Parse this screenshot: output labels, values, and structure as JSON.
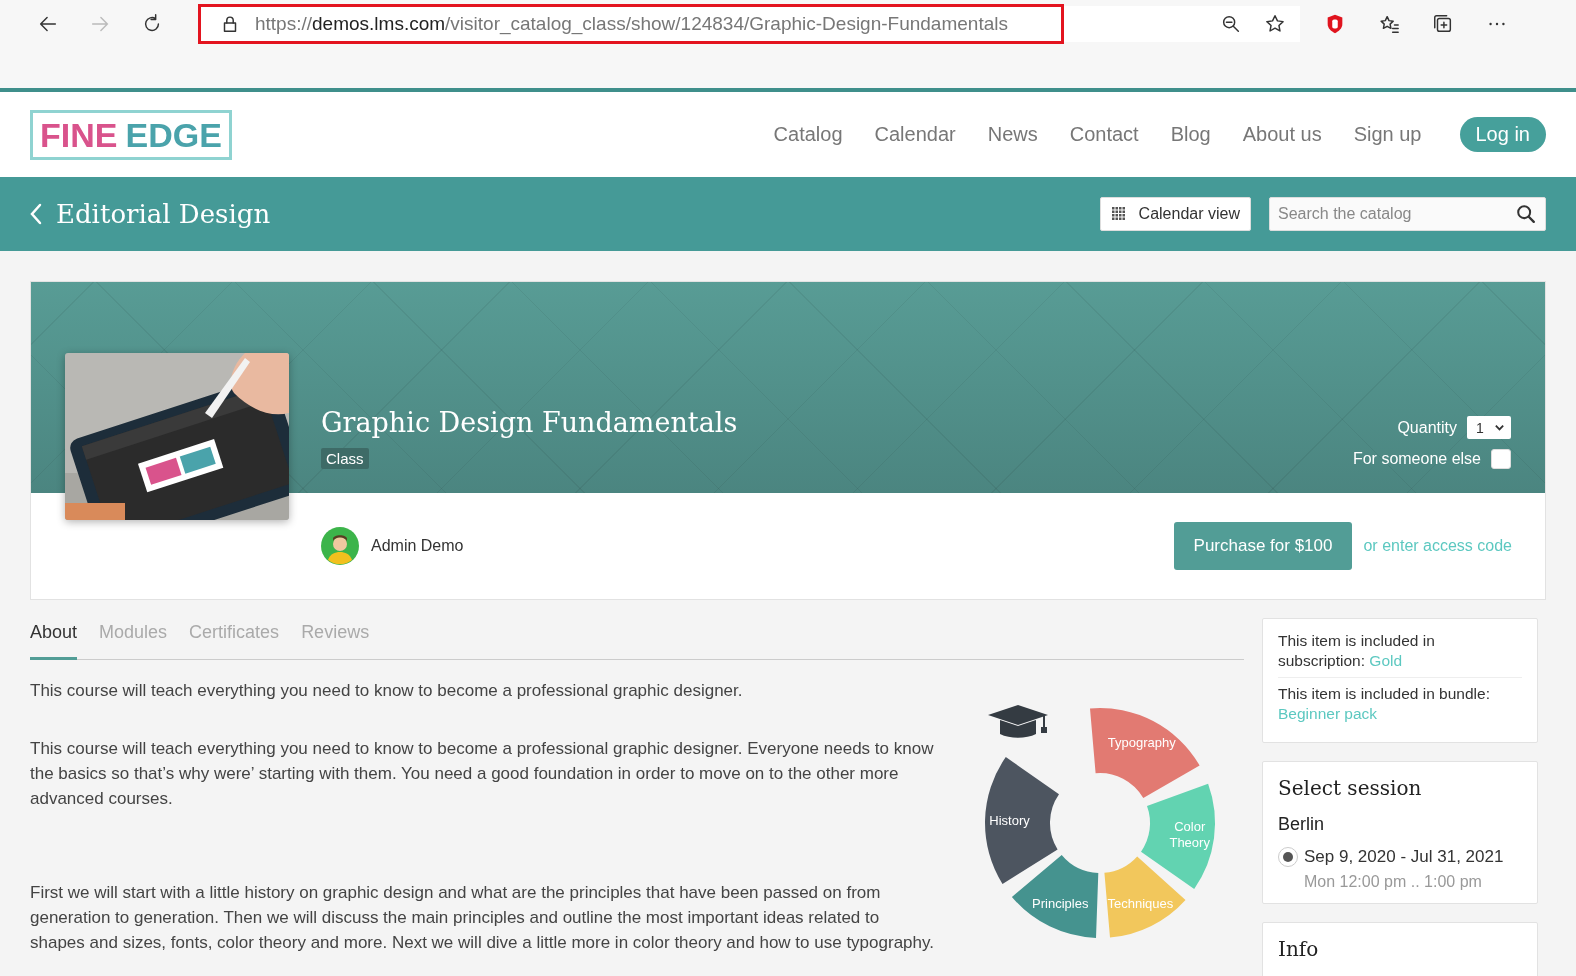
{
  "browser": {
    "url": {
      "scheme": "https://",
      "host": "demos.lms.com",
      "path": "/visitor_catalog_class/show/124834/Graphic-Design-Fundamentals"
    },
    "forward_disabled": true
  },
  "header": {
    "logo": {
      "first": "FINE",
      "second": "EDGE"
    },
    "nav": [
      {
        "label": "Catalog",
        "kind": "link"
      },
      {
        "label": "Calendar",
        "kind": "link"
      },
      {
        "label": "News",
        "kind": "link"
      },
      {
        "label": "Contact",
        "kind": "link"
      },
      {
        "label": "Blog",
        "kind": "link"
      },
      {
        "label": "About us",
        "kind": "link"
      },
      {
        "label": "Sign up",
        "kind": "link"
      },
      {
        "label": "Log in",
        "kind": "button"
      }
    ]
  },
  "catalog_bar": {
    "title": "Editorial Design",
    "calendar_button": "Calendar view",
    "search": {
      "placeholder": "Search the catalog"
    }
  },
  "course": {
    "title": "Graphic Design Fundamentals",
    "type_badge": "Class",
    "quantity_label": "Quantity",
    "quantity": "1",
    "for_someone_else": {
      "label": "For someone else",
      "checked": false
    },
    "author": "Admin Demo",
    "purchase_button": "Purchase for $100",
    "access_code_link": "or enter access code"
  },
  "tabs": [
    {
      "label": "About",
      "selected": true
    },
    {
      "label": "Modules",
      "selected": false
    },
    {
      "label": "Certificates",
      "selected": false
    },
    {
      "label": "Reviews",
      "selected": false
    }
  ],
  "about": {
    "paragraphs": [
      "This course will teach everything you need to know to become a professional graphic designer.",
      "This course will teach everything you need to know to become a professional graphic designer. Everyone needs to know the basics so that’s why were’ starting with them. You need a good foundation in order to move on to the other more advanced courses.",
      "First we will start with a little history on graphic design and what are the principles that have been passed on from generation to generation. Then we will discuss the main principles and outline the most important ideas related to shapes and sizes, fonts, color theory and more. Next we will dive a little more in color theory and how to use typography."
    ],
    "diagram": [
      {
        "label": "Typography",
        "color": "#e27a72"
      },
      {
        "label": "Color Theory",
        "color": "#62d3b1"
      },
      {
        "label": "Techniques",
        "color": "#f2c75c"
      },
      {
        "label": "Principles",
        "color": "#45938f"
      },
      {
        "label": "History",
        "color": "#4d5560"
      }
    ]
  },
  "sidebar": {
    "inclusions": [
      {
        "text": "This item is included in subscription:",
        "link": "Gold"
      },
      {
        "text": "This item is included in bundle:",
        "link": "Beginner pack"
      }
    ],
    "session": {
      "title": "Select session",
      "location": "Berlin",
      "options": [
        {
          "dates": "Sep 9, 2020 - Jul 31, 2021",
          "time": "Mon 12:00 pm .. 1:00 pm",
          "selected": true
        }
      ]
    },
    "info": {
      "title": "Info"
    }
  }
}
